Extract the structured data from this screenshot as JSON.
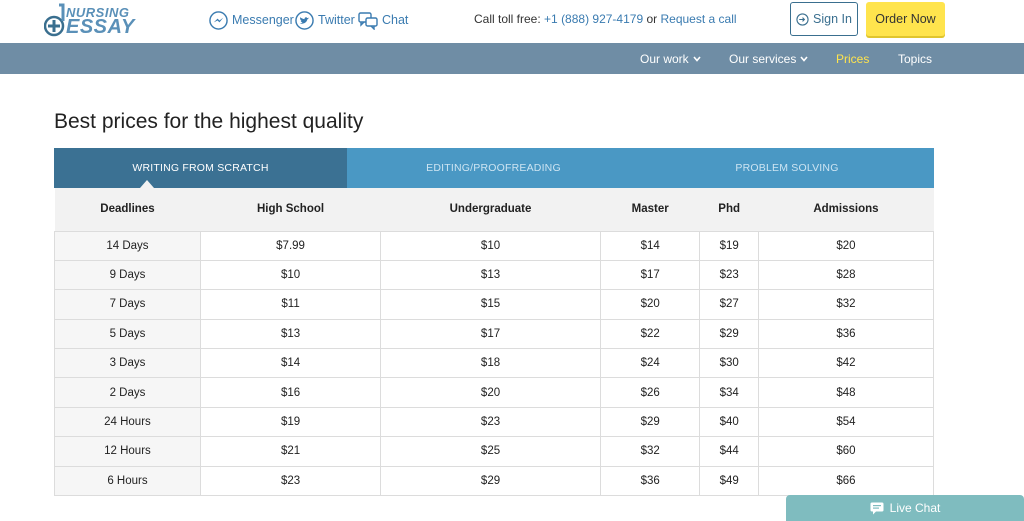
{
  "brand": {
    "line1": "NURSING",
    "line2": "ESSAY"
  },
  "social": {
    "messenger": "Messenger",
    "twitter": "Twitter",
    "chat": "Chat"
  },
  "contact": {
    "prefix": "Call toll free:",
    "phone": "+1 (888) 927-4179",
    "or": "or",
    "request": "Request a call"
  },
  "buttons": {
    "sign_in": "Sign In",
    "order_now": "Order Now"
  },
  "nav": {
    "our_work": "Our work",
    "our_services": "Our services",
    "prices": "Prices",
    "topics": "Topics"
  },
  "page": {
    "title": "Best prices for the highest quality"
  },
  "tabs": [
    "WRITING FROM SCRATCH",
    "EDITING/PROOFREADING",
    "PROBLEM SOLVING"
  ],
  "table": {
    "headers": [
      "Deadlines",
      "High School",
      "Undergraduate",
      "Master",
      "Phd",
      "Admissions"
    ],
    "rows": [
      [
        "14 Days",
        "$7.99",
        "$10",
        "$14",
        "$19",
        "$20"
      ],
      [
        "9 Days",
        "$10",
        "$13",
        "$17",
        "$23",
        "$28"
      ],
      [
        "7 Days",
        "$11",
        "$15",
        "$20",
        "$27",
        "$32"
      ],
      [
        "5 Days",
        "$13",
        "$17",
        "$22",
        "$29",
        "$36"
      ],
      [
        "3 Days",
        "$14",
        "$18",
        "$24",
        "$30",
        "$42"
      ],
      [
        "2 Days",
        "$16",
        "$20",
        "$26",
        "$34",
        "$48"
      ],
      [
        "24 Hours",
        "$19",
        "$23",
        "$29",
        "$40",
        "$54"
      ],
      [
        "12 Hours",
        "$21",
        "$25",
        "$32",
        "$44",
        "$60"
      ],
      [
        "6 Hours",
        "$23",
        "$29",
        "$36",
        "$49",
        "$66"
      ]
    ]
  },
  "live_chat": "Live Chat",
  "colors": {
    "nav_bg": "#6f8da5",
    "tab_active": "#3b7193",
    "tab_bg": "#4a98c4",
    "accent_yellow": "#ffe44d",
    "link_blue": "#3a7bb0",
    "live_chat_bg": "#7fbcbf"
  },
  "icons": {
    "logo": "medical-cross-icon",
    "messenger": "messenger-icon",
    "twitter": "twitter-bird-icon",
    "chat": "chat-bubbles-icon",
    "sign_in": "sign-in-icon",
    "chevron": "chevron-down-icon",
    "live_chat": "chat-bubble-icon"
  }
}
